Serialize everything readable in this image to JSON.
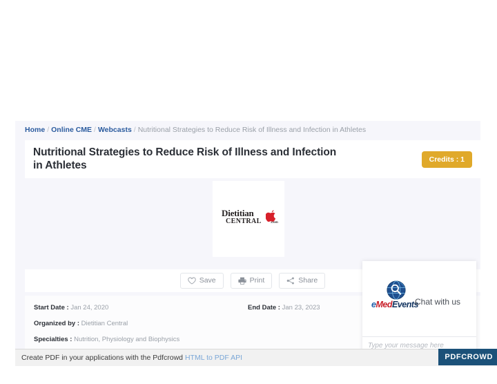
{
  "breadcrumb": {
    "items": [
      {
        "label": "Home",
        "type": "link"
      },
      {
        "label": "Online CME",
        "type": "link"
      },
      {
        "label": "Webcasts",
        "type": "link"
      },
      {
        "label": "Nutritional Strategies to Reduce Risk of Illness and Infection in Athletes",
        "type": "current"
      }
    ],
    "separator": "/"
  },
  "header": {
    "title": "Nutritional Strategies to Reduce Risk of Illness and Infection in Athletes",
    "credits_badge": "Credits : 1",
    "credits_badge_color": "#e0a92a"
  },
  "logo": {
    "name": "dietitian-central-logo",
    "line1": "Dietitian",
    "line2": "CENTRAL",
    "tld": ".com",
    "mark_color": "#d7202a",
    "text_color": "#231f20"
  },
  "actions": [
    {
      "id": "save",
      "label": "Save",
      "icon": "heart-icon"
    },
    {
      "id": "print",
      "label": "Print",
      "icon": "printer-icon"
    },
    {
      "id": "share",
      "label": "Share",
      "icon": "share-nodes-icon"
    }
  ],
  "details": {
    "start_date": {
      "label": "Start Date :",
      "value": "Jan 24, 2020"
    },
    "end_date": {
      "label": "End Date :",
      "value": "Jan 23, 2023"
    },
    "organized_by": {
      "label": "Organized by :",
      "value": "Dietitian Central"
    },
    "specialties": {
      "label": "Specialties :",
      "value": "Nutrition, Physiology and Biophysics"
    }
  },
  "chat": {
    "brand_e": "e",
    "brand_med": "Med",
    "brand_events": "Events",
    "title": "Chat with us",
    "input_placeholder": "Type your message here",
    "input_value": "",
    "brand_colors": {
      "e": "#1f5fa9",
      "med": "#c8202a",
      "events": "#12335f"
    }
  },
  "footer": {
    "text_before": "Create PDF in your applications with the Pdfcrowd",
    "link_label": "HTML to PDF API",
    "badge_label": "PDFCROWD",
    "badge_color": "#1b5179"
  }
}
